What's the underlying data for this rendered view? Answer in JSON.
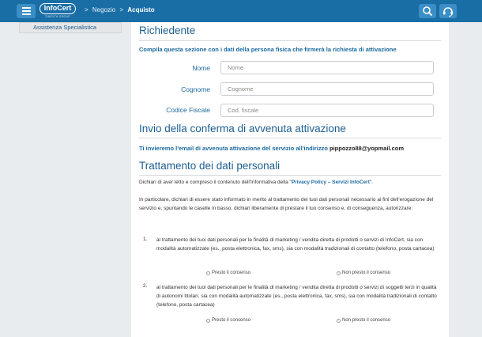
{
  "header": {
    "logo_text": "InfoCert",
    "logo_subtext": "TINEXTA GROUP",
    "breadcrumb": [
      {
        "label": "Negozio"
      },
      {
        "label": "Acquisto"
      }
    ],
    "breadcrumb_separator": ">",
    "icons": [
      "menu-icon",
      "search-icon",
      "headset-icon"
    ],
    "bar_color": "#1a6ea6"
  },
  "sidebar": {
    "items": [
      {
        "label": "Assistenza Specialistica"
      }
    ]
  },
  "richiedente": {
    "title": "Richiedente",
    "intro": "Compila questa sezione con i dati della persona fisica che firmerà la richiesta di attivazione",
    "fields": [
      {
        "label": "Nome",
        "placeholder": "Nome",
        "value": ""
      },
      {
        "label": "Cognome",
        "placeholder": "Cognome",
        "value": ""
      },
      {
        "label": "Codice Fiscale",
        "placeholder": "Cod. fiscale",
        "value": ""
      }
    ]
  },
  "conferma": {
    "title": "Invio della conferma di avvenuta attivazione",
    "text": "Ti invieremo l'email di avvenuta attivazione del servizio all'indirizzo",
    "email": "pippozzo88@yopmail.com"
  },
  "trattamento": {
    "title": "Trattamento dei dati personali",
    "p1_before": "Dichiari di aver letto e compreso il contenuto dell'Informativa della \"",
    "p1_link": "Privacy Policy – Servizi InfoCert",
    "p1_after": "\".",
    "p2": "In particolare, dichiari di essere stato informato in merito al trattamento dei tuoi dati personali necessario ai fini dell'erogazione del servizio e, spuntando le caselle in basso, dichiari liberamente di prestare il tuo consenso e, di conseguenza, autorizzare:",
    "items": [
      {
        "number": "1.",
        "text": "al trattamento dei tuoi dati personali per le finalità di marketing / vendita diretta di prodotti o servizi di InfoCert, sia con modalità automatizzate (es., posta elettronica, fax, sms), sia con modalità tradizionali di contatto (telefono, posta cartacea)",
        "yes": "Presto il consenso",
        "no": "Non presto il consenso"
      },
      {
        "number": "2.",
        "text": "al trattamento dei tuoi dati personali per le finalità di marketing / vendita diretta di prodotti o servizi di soggetti terzi in qualità di autonomi titolari, sia con modalità automatizzate (es., posta elettronica, fax, sms), sia con modalità tradizionali di contatto (telefono, posta cartacea)",
        "yes": "Presto il consenso",
        "no": "Non presto il consenso"
      }
    ]
  }
}
